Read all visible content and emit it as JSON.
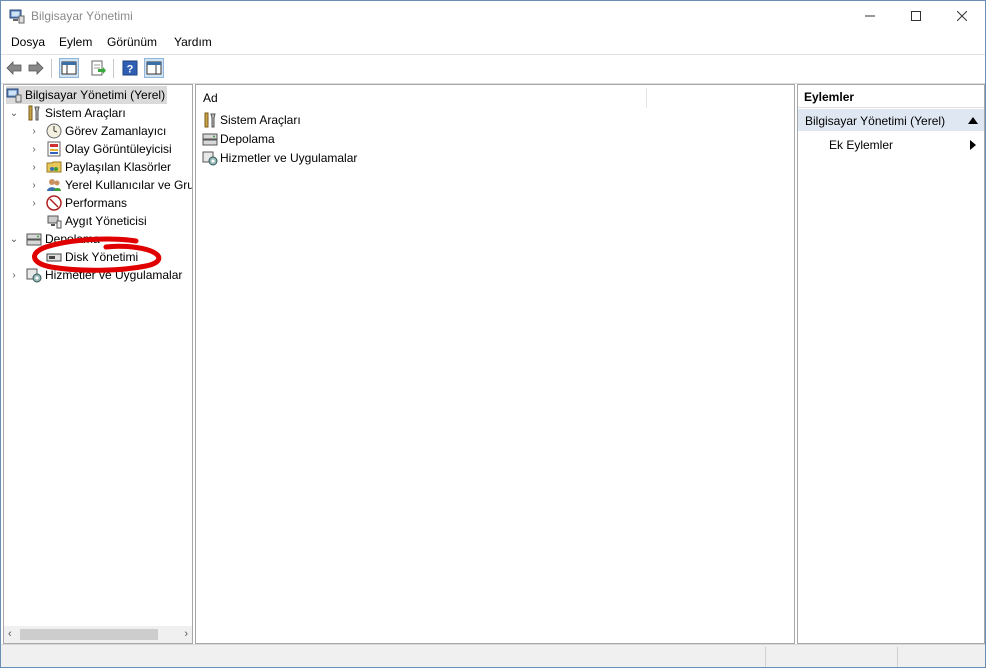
{
  "window": {
    "title": "Bilgisayar Yönetimi"
  },
  "menu": [
    "Dosya",
    "Eylem",
    "Görünüm",
    "Yardım"
  ],
  "toolbar": {
    "buttons": [
      "back-icon",
      "forward-icon",
      "show-hide-console-tree-icon",
      "export-list-icon",
      "help-icon",
      "show-hide-action-pane-icon"
    ]
  },
  "tree": {
    "root": "Bilgisayar Yönetimi (Yerel)",
    "system_tools": "Sistem Araçları",
    "task_scheduler": "Görev Zamanlayıcı",
    "event_viewer": "Olay Görüntüleyicisi",
    "shared_folders": "Paylaşılan Klasörler",
    "local_users": "Yerel Kullanıcılar ve Gru",
    "performance": "Performans",
    "device_manager": "Aygıt Yöneticisi",
    "storage": "Depolama",
    "disk_management": "Disk Yönetimi",
    "services_apps": "Hizmetler ve Uygulamalar"
  },
  "center": {
    "column_header": "Ad",
    "items": [
      "Sistem Araçları",
      "Depolama",
      "Hizmetler ve Uygulamalar"
    ]
  },
  "actions": {
    "header": "Eylemler",
    "section": "Bilgisayar Yönetimi (Yerel)",
    "more_actions": "Ek Eylemler"
  },
  "colors": {
    "selection": "#dadada",
    "action_section": "#dfe8f2",
    "annotation": "#e00000"
  }
}
